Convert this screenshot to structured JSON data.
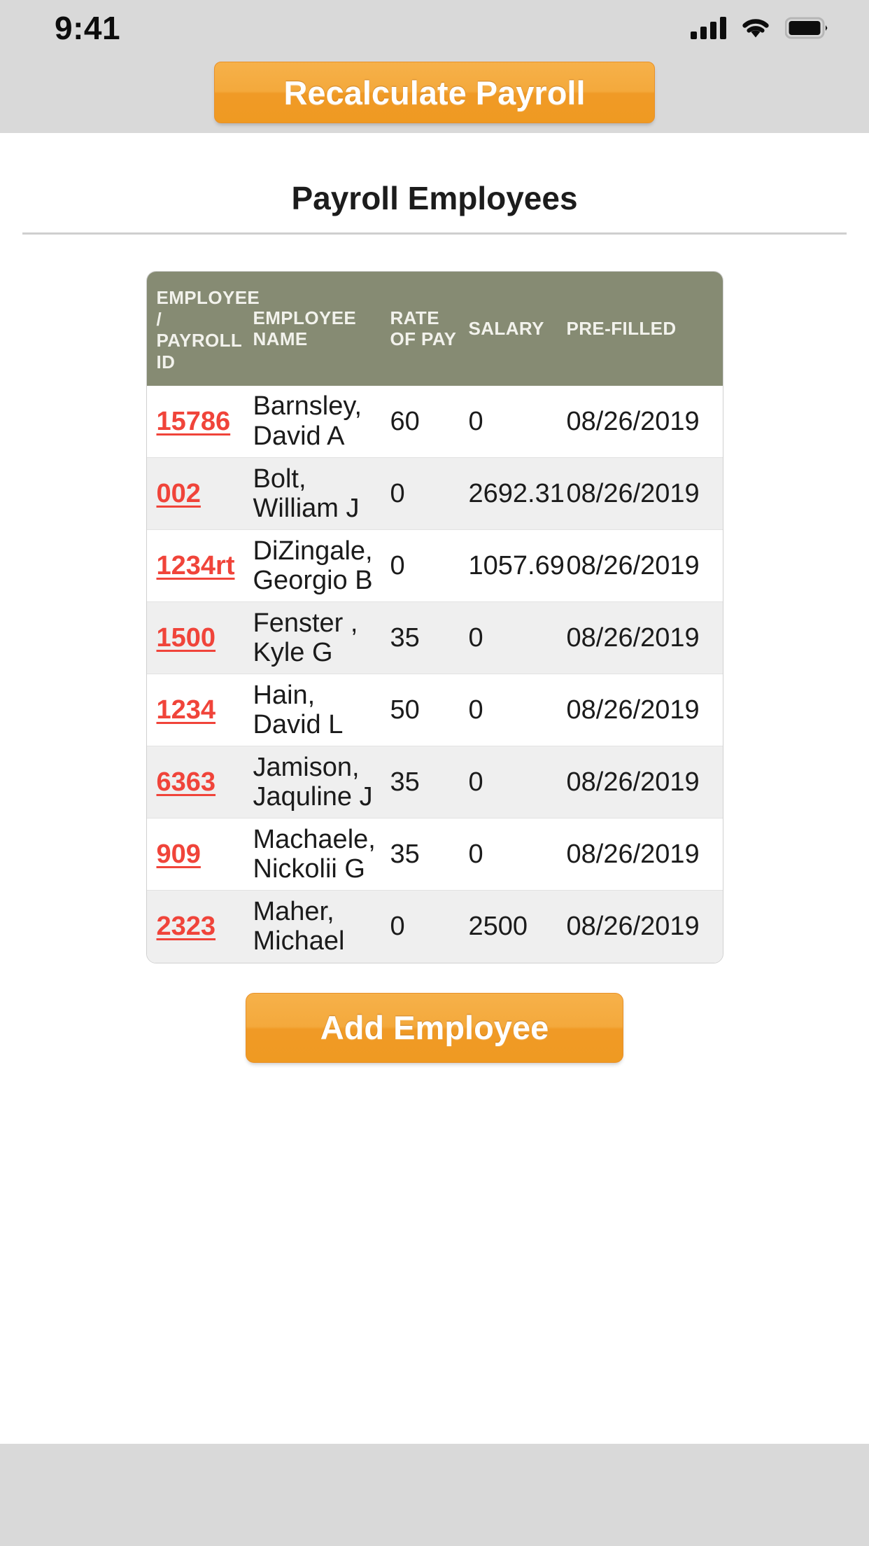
{
  "status_bar": {
    "time": "9:41",
    "icons": [
      "signal-bars-icon",
      "wifi-icon",
      "battery-icon"
    ]
  },
  "toolbar": {
    "recalculate_label": "Recalculate Payroll"
  },
  "card": {
    "title": "Payroll Employees"
  },
  "table": {
    "columns": [
      {
        "key": "id",
        "label": "EMPLOYEE / PAYROLL ID"
      },
      {
        "key": "name",
        "label": "EMPLOYEE NAME"
      },
      {
        "key": "rate",
        "label": "RATE OF PAY"
      },
      {
        "key": "salary",
        "label": "SALARY"
      },
      {
        "key": "prefilled",
        "label": "PRE-FILLED"
      }
    ],
    "column_labels": {
      "id_line1": "EMPLOYEE",
      "id_line2": "/",
      "id_line3": "PAYROLL",
      "id_line4": "ID",
      "name_line1": "EMPLOYEE",
      "name_line2": "NAME",
      "rate_line1": "RATE",
      "rate_line2": "OF PAY",
      "salary": "SALARY",
      "prefilled": "PRE-FILLED"
    },
    "rows": [
      {
        "id": "15786",
        "name": "Barnsley, David A",
        "rate": "60",
        "salary": "0",
        "prefilled": "08/26/2019"
      },
      {
        "id": "002",
        "name": "Bolt, William J",
        "rate": "0",
        "salary": "2692.31",
        "prefilled": "08/26/2019"
      },
      {
        "id": "1234rt",
        "name": "DiZingale, Georgio B",
        "rate": "0",
        "salary": "1057.69",
        "prefilled": "08/26/2019"
      },
      {
        "id": "1500",
        "name": "Fenster , Kyle G",
        "rate": "35",
        "salary": "0",
        "prefilled": "08/26/2019"
      },
      {
        "id": "1234",
        "name": "Hain, David L",
        "rate": "50",
        "salary": "0",
        "prefilled": "08/26/2019"
      },
      {
        "id": "6363",
        "name": "Jamison, Jaquline J",
        "rate": "35",
        "salary": "0",
        "prefilled": "08/26/2019"
      },
      {
        "id": "909",
        "name": "Machaele, Nickolii G",
        "rate": "35",
        "salary": "0",
        "prefilled": "08/26/2019"
      },
      {
        "id": "2323",
        "name": "Maher, Michael",
        "rate": "0",
        "salary": "2500",
        "prefilled": "08/26/2019"
      }
    ]
  },
  "footer": {
    "add_employee_label": "Add Employee"
  },
  "colors": {
    "accent_orange": "#f0a02b",
    "table_header": "#868b73",
    "link_red": "#f0443a",
    "page_background": "#d9d9d9",
    "card_background": "#ffffff",
    "row_alt": "#efefef"
  }
}
